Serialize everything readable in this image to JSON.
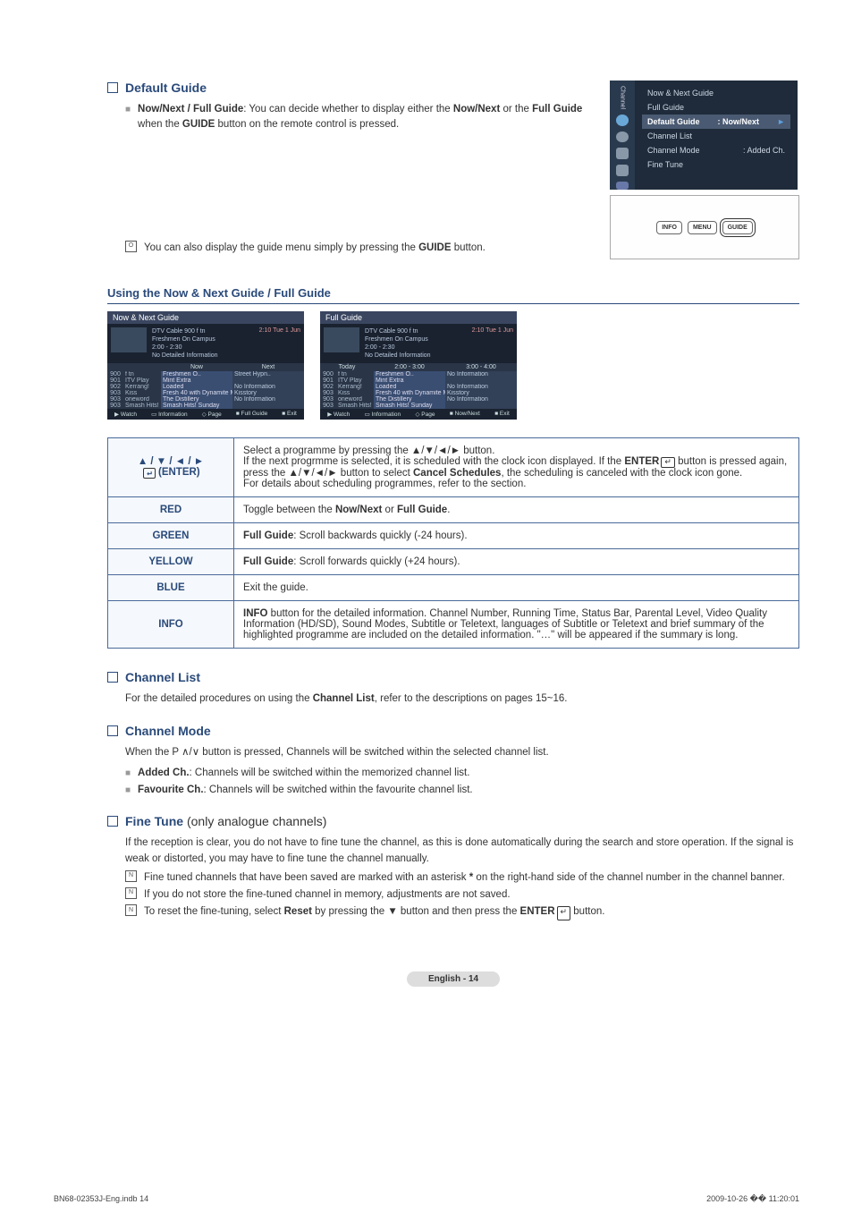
{
  "sections": {
    "default_guide": {
      "title": "Default Guide",
      "bullet_label": "Now/Next / Full Guide",
      "bullet_text_1": ": You can decide whether to display either the ",
      "bullet_bold_1": "Now/Next",
      "bullet_text_2": " or the ",
      "bullet_bold_2": "Full Guide",
      "bullet_text_3": " when the ",
      "bullet_bold_3": "GUIDE",
      "bullet_text_4": " button on the remote control is pressed.",
      "note_text_1": "You can also display the guide menu simply by pressing the ",
      "note_bold": "GUIDE",
      "note_text_2": " button."
    },
    "channel_list": {
      "title": "Channel List",
      "text_1": "For the detailed procedures on using the ",
      "bold_1": "Channel List",
      "text_2": ", refer to the descriptions on pages 15~16."
    },
    "channel_mode": {
      "title": "Channel Mode",
      "intro": "When the P ∧/∨ button is pressed, Channels will be switched within the selected channel list.",
      "b1_label": "Added Ch.",
      "b1_text": ": Channels will be switched within the memorized channel list.",
      "b2_label": "Favourite Ch.",
      "b2_text": ": Channels will be switched within the favourite channel list."
    },
    "fine_tune": {
      "title": "Fine Tune",
      "suffix": " (only analogue channels)",
      "intro": "If the reception is clear, you do not have to fine tune the channel, as this is done automatically during the search and store operation. If the signal is weak or distorted, you may have to fine tune the channel manually.",
      "n1_a": "Fine tuned channels that have been saved are marked with an asterisk ",
      "n1_b": "*",
      "n1_c": " on the right-hand side of the channel number in the channel banner.",
      "n2": "If you do not store the fine-tuned channel in memory, adjustments are not saved.",
      "n3_a": "To reset the fine-tuning, select ",
      "n3_b": "Reset",
      "n3_c": " by pressing the ▼ button and then press the ",
      "n3_d": "ENTER",
      "n3_e": " button."
    }
  },
  "menu_panel": {
    "side_label": "Channel",
    "items": [
      {
        "left": "Now & Next Guide",
        "right": ""
      },
      {
        "left": "Full Guide",
        "right": ""
      },
      {
        "left": "Default Guide",
        "right": ": Now/Next",
        "highlight": true
      },
      {
        "left": "Channel List",
        "right": ""
      },
      {
        "left": "Channel Mode",
        "right": ": Added Ch."
      },
      {
        "left": "Fine Tune",
        "right": ""
      }
    ]
  },
  "remote_buttons": [
    "INFO",
    "MENU",
    "GUIDE"
  ],
  "using_title": "Using the Now & Next Guide / Full Guide",
  "guide_header_info": {
    "channel": "DTV Cable 900 f tn",
    "prog": "Freshmen On Campus",
    "time_range": "2:00 - 2:30",
    "detail": "No Detailed Information",
    "clock": "2:10 Tue 1 Jun"
  },
  "now_next_guide": {
    "title": "Now & Next Guide",
    "col1": "Now",
    "col2": "Next",
    "rows": [
      {
        "ch": "900",
        "name": "f tn",
        "now": "Freshmen O..",
        "next": "Street Hypn.."
      },
      {
        "ch": "901",
        "name": "ITV Play",
        "now": "Mint Extra",
        "next": ""
      },
      {
        "ch": "902",
        "name": "Kerrang!",
        "now": "Loaded",
        "next": "No Information"
      },
      {
        "ch": "903",
        "name": "Kiss",
        "now": "Fresh 40 with Dynamite MC",
        "next": "Kisstory"
      },
      {
        "ch": "903",
        "name": "oneword",
        "now": "The Distillery",
        "next": "No Information"
      },
      {
        "ch": "903",
        "name": "Smash Hits!",
        "now": "Smash Hits! Sunday",
        "next": ""
      }
    ],
    "footer": [
      "Watch",
      "Information",
      "Page",
      "Full Guide",
      "Exit"
    ]
  },
  "full_guide": {
    "title": "Full Guide",
    "col0": "Today",
    "col1": "2:00 - 3:00",
    "col2": "3:00 - 4:00",
    "rows": [
      {
        "ch": "900",
        "name": "f tn",
        "now": "Freshmen O..",
        "next": "No Information"
      },
      {
        "ch": "901",
        "name": "ITV Play",
        "now": "Mint Extra",
        "next": ""
      },
      {
        "ch": "902",
        "name": "Kerrang!",
        "now": "Loaded",
        "next": "No Information"
      },
      {
        "ch": "903",
        "name": "Kiss",
        "now": "Fresh 40 with Dynamite MC",
        "next": "Kisstory"
      },
      {
        "ch": "903",
        "name": "oneword",
        "now": "The Distillery",
        "next": "No Information"
      },
      {
        "ch": "903",
        "name": "Smash Hits!",
        "now": "Smash Hits! Sunday",
        "next": ""
      }
    ],
    "footer": [
      "Watch",
      "Information",
      "Page",
      "Now/Next",
      "Exit"
    ]
  },
  "controls_table": {
    "r1": {
      "key_arrows": "▲ / ▼ / ◄ / ►",
      "key_enter": "(ENTER)",
      "desc_a": "Select a programme by pressing the ▲/▼/◄/► button.",
      "desc_b_1": "If the next progrmme is selected, it is scheduled with the clock icon displayed. If the ",
      "desc_b_2": "ENTER",
      "desc_b_3": " button is pressed again, press the ▲/▼/◄/► button to select ",
      "desc_b_4": "Cancel Schedules",
      "desc_b_5": ", the scheduling is canceled with the clock icon gone.",
      "desc_c": "For details about scheduling programmes, refer to the section."
    },
    "r2": {
      "key": "RED",
      "desc_a": "Toggle between the ",
      "desc_b": "Now/Next",
      "desc_c": " or ",
      "desc_d": "Full Guide",
      "desc_e": "."
    },
    "r3": {
      "key": "GREEN",
      "desc_a": "Full Guide",
      "desc_b": ": Scroll backwards quickly (-24 hours)."
    },
    "r4": {
      "key": "YELLOW",
      "desc_a": "Full Guide",
      "desc_b": ": Scroll forwards quickly (+24 hours)."
    },
    "r5": {
      "key": "BLUE",
      "desc": "Exit the guide."
    },
    "r6": {
      "key": "INFO",
      "desc_a": "INFO",
      "desc_b": " button for the detailed information. Channel Number, Running Time, Status Bar, Parental Level, Video Quality Information (HD/SD), Sound Modes, Subtitle or Teletext, languages of Subtitle or Teletext and brief summary of the highlighted programme are included on the detailed information. \"…\" will be appeared if the summary is long."
    }
  },
  "page_label": "English - 14",
  "print_footer": {
    "left": "BN68-02353J-Eng.indb   14",
    "right": "2009-10-26   �� 11:20:01"
  }
}
